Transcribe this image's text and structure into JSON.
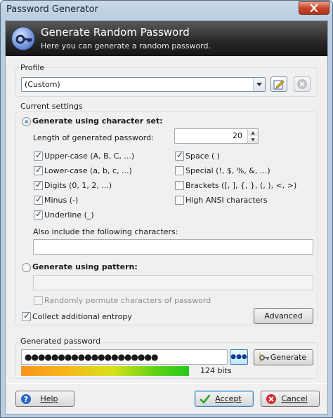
{
  "window": {
    "title": "Password Generator"
  },
  "banner": {
    "title": "Generate Random Password",
    "subtitle": "Here you can generate a random password."
  },
  "profile": {
    "legend": "Profile",
    "selected": "(Custom)"
  },
  "settings": {
    "legend": "Current settings",
    "charset_radio": "Generate using character set:",
    "length_label": "Length of generated password:",
    "length_value": "20",
    "options": [
      {
        "label": "Upper-case (A, B, C, ...)",
        "checked": true
      },
      {
        "label": "Lower-case (a, b, c, ...)",
        "checked": true
      },
      {
        "label": "Digits (0, 1, 2, ...)",
        "checked": true
      },
      {
        "label": "Minus (-)",
        "checked": true
      },
      {
        "label": "Underline (_)",
        "checked": true
      },
      {
        "label": "Space ( )",
        "checked": true
      },
      {
        "label": "Special (!, $, %, &, ...)",
        "checked": false
      },
      {
        "label": "Brackets ([, ], {, }, (, ), <, >)",
        "checked": false
      },
      {
        "label": "High ANSI characters",
        "checked": false
      }
    ],
    "also_include_label": "Also include the following characters:",
    "also_include_value": "",
    "pattern_radio": "Generate using pattern:",
    "pattern_value": "",
    "permute_label": "Randomly permute characters of password",
    "entropy_label": "Collect additional entropy",
    "advanced_button": "Advanced"
  },
  "generated": {
    "legend": "Generated password",
    "password_mask": "●●●●●●●●●●●●●●●●●●●●",
    "quality_fraction": 0.64,
    "bits_label": "124 bits",
    "dots_label": "●●●",
    "generate_button": "Generate"
  },
  "footer": {
    "help_button": "Help",
    "accept_button": "Accept",
    "cancel_button": "Cancel"
  },
  "colors": {
    "banner": "#2a2a2a",
    "accent": "#3c7fb1",
    "quality_start": "#f7941d",
    "quality_end": "#25c91a"
  },
  "icons": [
    "key-icon",
    "close-icon",
    "edit-profile-icon",
    "delete-profile-icon",
    "help-icon",
    "accept-icon",
    "cancel-icon",
    "generate-icon",
    "dropdown-arrow-icon"
  ]
}
